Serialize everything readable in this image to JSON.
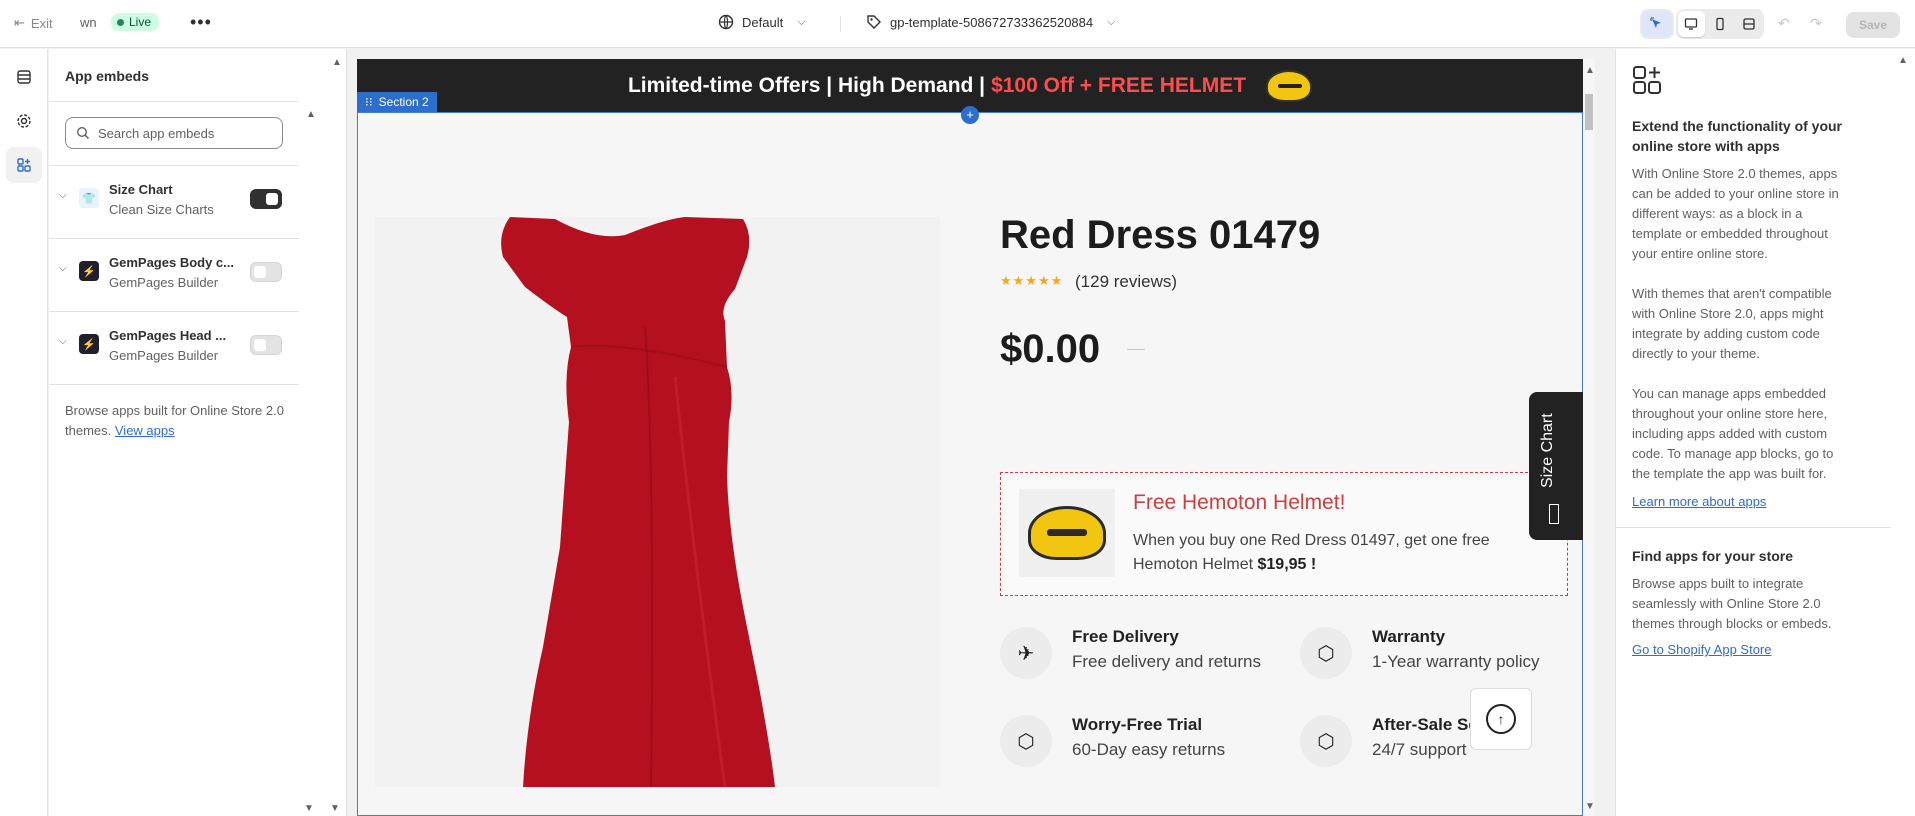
{
  "topbar": {
    "exit_label": "Exit",
    "store_initials": "wn",
    "status_label": "Live",
    "more_glyph": "•••",
    "theme_label": "Default",
    "template_label": "gp-template-508672733362520884",
    "save_label": "Save"
  },
  "left_panel": {
    "title": "App embeds",
    "search_placeholder": "Search app embeds",
    "embeds": [
      {
        "name": "Size Chart",
        "provider": "Clean Size Charts",
        "enabled": true
      },
      {
        "name": "GemPages Body c...",
        "provider": "GemPages Builder",
        "enabled": false
      },
      {
        "name": "GemPages Head ...",
        "provider": "GemPages Builder",
        "enabled": false
      }
    ],
    "browse_text": "Browse apps built for Online Store 2.0 themes.",
    "browse_link": "View apps"
  },
  "canvas": {
    "announcement_white": "Limited-time Offers | High Demand |",
    "announcement_red": "$100 Off + FREE HELMET",
    "section_label": "Section 2",
    "product_title": "Red Dress 01479",
    "stars": "★★★★★",
    "reviews": "(129 reviews)",
    "price": "$0.00",
    "promo_title": "Free Hemoton Helmet!",
    "promo_text": "When you buy one Red Dress 01497, get one free Hemoton Helmet",
    "promo_price": "$19,95 !",
    "features": [
      {
        "title": "Free Delivery",
        "subtitle": "Free delivery and returns",
        "icon": "plane-icon"
      },
      {
        "title": "Warranty",
        "subtitle": "1-Year warranty policy",
        "icon": "box-icon"
      },
      {
        "title": "Worry-Free Trial",
        "subtitle": "60-Day easy returns",
        "icon": "package-icon"
      },
      {
        "title": "After-Sale Se",
        "subtitle": "24/7 support",
        "icon": "package-icon"
      }
    ],
    "size_chart_tab": "Size Chart"
  },
  "right_panel": {
    "heading1": "Extend the functionality of your online store with apps",
    "para1": "With Online Store 2.0 themes, apps can be added to your online store in different ways: as a block in a template or embedded throughout your entire online store.",
    "para2": "With themes that aren't compatible with Online Store 2.0, apps might integrate by adding custom code directly to your theme.",
    "para3": "You can manage apps embedded throughout your online store here, including apps added with custom code. To manage app blocks, go to the template the app was built for.",
    "link1": "Learn more about apps",
    "heading2": "Find apps for your store",
    "para4": "Browse apps built to integrate seamlessly with Online Store 2.0 themes through blocks or embeds.",
    "link2": "Go to Shopify App Store"
  },
  "colors": {
    "accent": "#2c6ecb",
    "promo_red": "#d23c3c",
    "announcement_red": "#ff4d4d",
    "dress_red": "#b5101f",
    "live_green": "#29845a"
  }
}
